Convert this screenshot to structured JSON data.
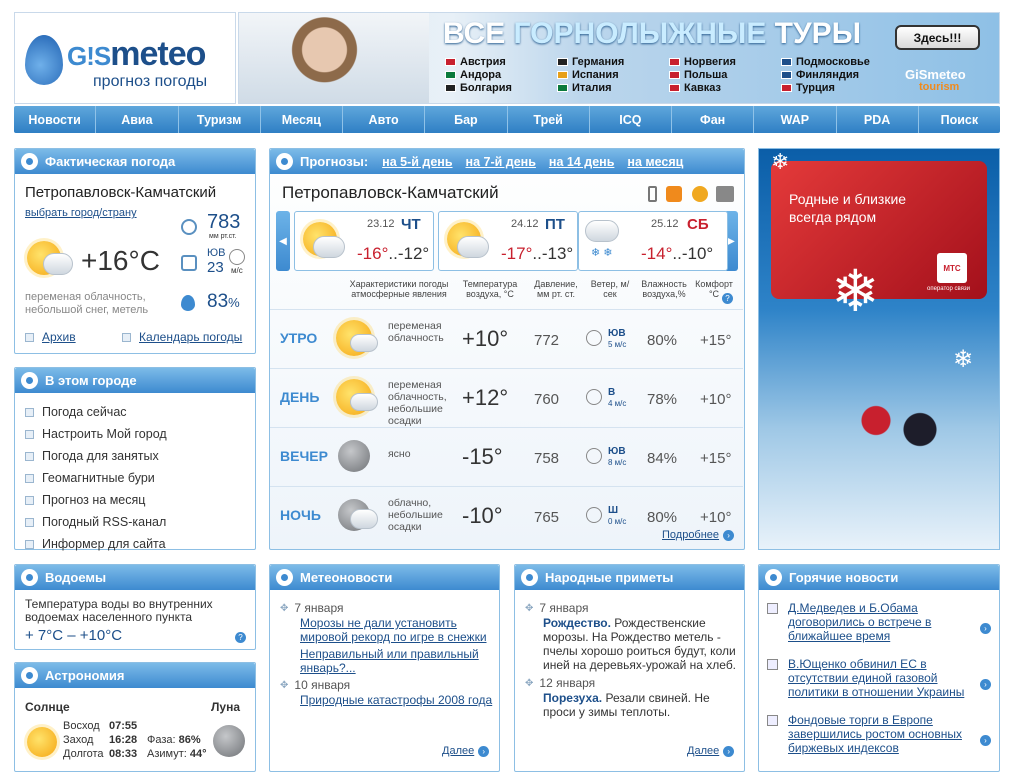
{
  "logo": {
    "brand_g": "G!S",
    "brand_meteo": "meteo",
    "tagline": "прогноз погоды"
  },
  "banner": {
    "title_a": "ВСЕ ",
    "title_b": "ГОРНОЛЫЖНЫЕ",
    "title_c": " ТУРЫ",
    "button": "Здесь!!!",
    "brand": "GiSmeteo",
    "brand2": "tourism",
    "countries": [
      [
        "Австрия",
        "Андора",
        "Болгария"
      ],
      [
        "Германия",
        "Испания",
        "Италия"
      ],
      [
        "Норвегия",
        "Польша",
        "Кавказ"
      ],
      [
        "Подмосковье",
        "Финляндия",
        "Турция"
      ]
    ]
  },
  "nav": [
    "Новости",
    "Авиа",
    "Туризм",
    "Месяц",
    "Авто",
    "Бар",
    "Трей",
    "ICQ",
    "Фан",
    "WAP",
    "PDA",
    "Поиск"
  ],
  "actual": {
    "title": "Фактическая погода",
    "city": "Петропавловск-Камчатский",
    "choose": "выбрать город/страну",
    "temp": "+16°C",
    "pressure": "783",
    "pressure_unit": "мм рт.ст.",
    "wind_dir": "ЮВ",
    "wind": "23",
    "wind_unit": "м/с",
    "desc": "переменая облачность, небольшой снег, метель",
    "humidity": "83",
    "humidity_unit": "%",
    "archive": "Архив",
    "calendar": "Календарь погоды"
  },
  "city_links": {
    "title": "В этом городе",
    "items": [
      "Погода сейчас",
      "Настроить Мой город",
      "Погода для занятых",
      "Геомагнитные бури",
      "Прогноз на месяц",
      "Погодный RSS-канал",
      "Информер для сайта"
    ]
  },
  "water": {
    "title": "Водоемы",
    "text": "Температура воды во внутренних водоемах населенного пункта",
    "temp": "+ 7°C – +10°C"
  },
  "astro": {
    "title": "Астрономия",
    "sun": "Солнце",
    "moon": "Луна",
    "rise_l": "Восход",
    "rise": "07:55",
    "set_l": "Заход",
    "set": "16:28",
    "len_l": "Долгота",
    "len": "08:33",
    "phase_l": "Фаза:",
    "phase": "86%",
    "az_l": "Азимут:",
    "az": "44°"
  },
  "forecast": {
    "title": "Прогнозы:",
    "tabs": [
      "на 5-й день",
      "на 7-й день",
      "на 14 день",
      "на месяц"
    ],
    "city": "Петропавловск-Камчатский",
    "days": [
      {
        "date": "23.12",
        "dow": "ЧТ",
        "t1": "-16°",
        "t2": "-12°"
      },
      {
        "date": "24.12",
        "dow": "ПТ",
        "t1": "-17°",
        "t2": "-13°"
      },
      {
        "date": "25.12",
        "dow": "СБ",
        "t1": "-14°",
        "t2": "-10°"
      }
    ],
    "headers": [
      "Характеристики погоды атмосферные явления",
      "Температура воздуха, °C",
      "Давление, мм рт. ст.",
      "Ветер, м/сек",
      "Влажность воздуха,%",
      "Комфорт °C"
    ],
    "rows": [
      {
        "label": "УТРО",
        "desc": "переменая облачность",
        "temp": "+10°",
        "press": "772",
        "dir": "ЮВ",
        "wind": "5 м/с",
        "hum": "80%",
        "comf": "+15°"
      },
      {
        "label": "ДЕНЬ",
        "desc": "переменая облачность, небольшие осадки",
        "temp": "+12°",
        "press": "760",
        "dir": "В",
        "wind": "4 м/с",
        "hum": "78%",
        "comf": "+10°"
      },
      {
        "label": "ВЕЧЕР",
        "desc": "ясно",
        "temp": "-15°",
        "press": "758",
        "dir": "ЮВ",
        "wind": "8 м/с",
        "hum": "84%",
        "comf": "+15°"
      },
      {
        "label": "НОЧЬ",
        "desc": "облачно, небольшие осадки",
        "temp": "-10°",
        "press": "765",
        "dir": "Ш",
        "wind": "0 м/с",
        "hum": "80%",
        "comf": "+10°"
      }
    ],
    "more": "Подробнее"
  },
  "ad": {
    "text1": "Родные и близкие",
    "text2": "всегда рядом",
    "brand": "МТС",
    "brand_sub": "оператор связи"
  },
  "meteonews": {
    "title": "Метеоновости",
    "items": [
      {
        "date": "7 января",
        "links": [
          "Морозы не дали установить мировой рекорд по игре в снежки",
          "Неправильный или правильный январь?..."
        ]
      },
      {
        "date": "10 января",
        "links": [
          "Природные катастрофы 2008 года"
        ]
      }
    ],
    "more": "Далее"
  },
  "signs": {
    "title": "Народные приметы",
    "items": [
      {
        "date": "7 января",
        "bold": "Рождество.",
        "text": " Рождественские морозы. На Рождество метель - пчелы хорошо роиться будут, коли иней на деревьях-урожай на хлеб."
      },
      {
        "date": "12 января",
        "bold": "Порезуха.",
        "text": " Резали свиней. Не проси у зимы теплоты."
      }
    ],
    "more": "Далее"
  },
  "hot": {
    "title": "Горячие новости",
    "items": [
      "Д.Медведев и Б.Обама договорились о встрече в ближайшее время",
      "В.Ющенко обвинил ЕС в отсутствии единой газовой политики в отношении Украины",
      "Фондовые торги в Европе завершились ростом основных биржевых индексов"
    ]
  }
}
